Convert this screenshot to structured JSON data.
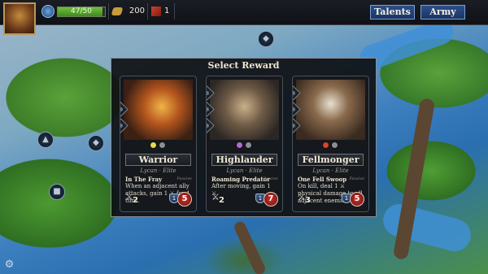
{
  "player": {
    "xp_text": "47/50",
    "xp_fraction": 0.94,
    "gold": "200",
    "shards": "1"
  },
  "buttons": {
    "talents": "Talents",
    "army": "Army"
  },
  "map": {
    "icons": [
      "crest-icon",
      "helm-icon",
      "shield-icon",
      "tower-icon",
      "settings-gear-icon"
    ]
  },
  "modal": {
    "title": "Select Reward",
    "cards": [
      {
        "name": "Warrior",
        "subtitle": "Lycan · Elite",
        "ability": "In The Fray",
        "ability_type": "Passive",
        "description": "When an adjacent ally attacks, gain 1 ⚔ for 1 turn.",
        "attack": "2",
        "defense": "1",
        "health": "5",
        "gem_colors": [
          "#e8d84a",
          "#8a8f98"
        ]
      },
      {
        "name": "Highlander",
        "subtitle": "Lycan · Elite",
        "ability": "Roaming Predator",
        "ability_type": "Passive",
        "description": "After moving, gain 1 ⚔.",
        "attack": "2",
        "defense": "1",
        "health": "7",
        "gem_colors": [
          "#b56ad6",
          "#8a8f98"
        ]
      },
      {
        "name": "Fellmonger",
        "subtitle": "Lycan · Elite",
        "ability": "One Fell Swoop",
        "ability_type": "Passive",
        "description": "On kill, deal 1 ⚔ physical damage to all adjacent enemies.",
        "attack": "3",
        "defense": "1",
        "health": "5",
        "gem_colors": [
          "#d9432f",
          "#8a8f98"
        ]
      }
    ]
  },
  "colors": {
    "button_bg": "#1d3562",
    "xp_fill": "#6fbf3c",
    "health": "#c8302a"
  }
}
